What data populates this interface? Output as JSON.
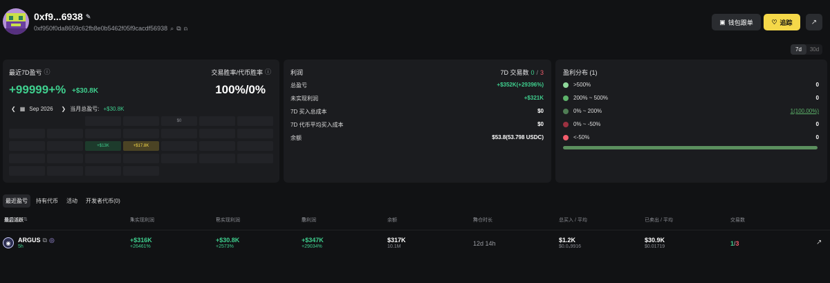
{
  "wallet": {
    "name": "0xf9...6938",
    "address": "0xf950f0da8659c62fb8e0b5462f05f9cacdf56938"
  },
  "actions": {
    "list_label": "钱包跟单",
    "follow_label": "追踪"
  },
  "range": {
    "options": [
      "7d",
      "30d"
    ],
    "selected": "7d"
  },
  "pnl_card": {
    "title": "最近7D盈亏",
    "pnl_percent": "+99999+%",
    "pnl_value": "+$30.8K",
    "winrate_title": "交易胜率/代币胜率",
    "winrate_value": "100%/0%",
    "calendar_month": "Sep 2026",
    "month_total_label": "当月总盈亏:",
    "month_total_value": "+$30.8K",
    "calendar_rows": [
      [
        "",
        "",
        "",
        "",
        "$0",
        "",
        ""
      ],
      [
        "",
        "",
        "",
        "",
        "",
        "",
        ""
      ],
      [
        "",
        "",
        "+$13K",
        "+$17.8K",
        "",
        "",
        ""
      ],
      [
        "",
        "",
        "",
        "",
        "",
        "",
        ""
      ],
      [
        "",
        "",
        "",
        "",
        "",
        "",
        ""
      ]
    ]
  },
  "profit_card": {
    "title": "利润",
    "trades_label": "7D 交易数",
    "trades_win": "0",
    "trades_sep": "/",
    "trades_lose": "3",
    "rows": [
      {
        "label": "总盈亏",
        "value": "+$352K(+29396%)"
      },
      {
        "label": "未实现利润",
        "value": "+$321K"
      },
      {
        "label": "7D 买入总成本",
        "value": "$0"
      },
      {
        "label": "7D 代币平均买入成本",
        "value": "$0"
      },
      {
        "label": "余额",
        "value": "$53.8(53.798 USDC)"
      }
    ]
  },
  "dist_card": {
    "title": "盈利分布 (1)",
    "rows": [
      {
        "label": ">500%",
        "value": "0",
        "color": "#8fd89b"
      },
      {
        "label": "200% ~ 500%",
        "value": "0",
        "color": "#5db36a"
      },
      {
        "label": "0% ~ 200%",
        "value": "1(100.00%)",
        "color": "#4f7d54"
      },
      {
        "label": "0% ~ -50%",
        "value": "0",
        "color": "#9b3140"
      },
      {
        "label": "<-50%",
        "value": "0",
        "color": "#f25d6c"
      }
    ]
  },
  "tabs": [
    "最近盈亏",
    "持有代币",
    "活动",
    "开发者代币(0)"
  ],
  "table": {
    "headers": [
      "币种 /",
      "最后活跃",
      "未实现利润",
      "已实现利润",
      "总利润",
      "余额",
      "持仓时长",
      "总买入 / 平均",
      "已卖出 / 平均",
      "交易数"
    ],
    "row": {
      "token": "ARGUS",
      "active": "5h",
      "unrealized": "+$316K",
      "unrealized_pct": "+26461%",
      "realized": "+$30.8K",
      "realized_pct": "+2573%",
      "total": "+$347K",
      "total_pct": "+29034%",
      "balance": "$317K",
      "balance_amt": "10.1M",
      "hold": "12d 14h",
      "bought": "$1.2K",
      "bought_avg": "$0.0₄9916",
      "sold": "$30.9K",
      "sold_avg": "$0.01719",
      "trades_win": "1",
      "trades_sep": "/",
      "trades_lose": "3"
    }
  }
}
